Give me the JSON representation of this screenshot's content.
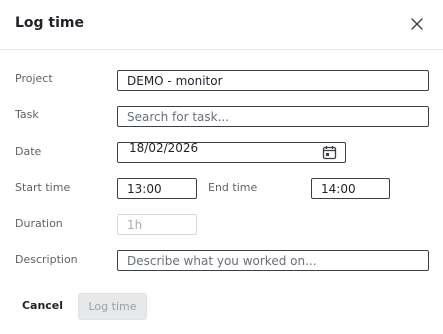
{
  "dialog": {
    "title": "Log time"
  },
  "form": {
    "project": {
      "label": "Project",
      "value": "DEMO - monitor"
    },
    "task": {
      "label": "Task",
      "placeholder": "Search for task..."
    },
    "date": {
      "label": "Date",
      "value": "18/02/2026"
    },
    "start_time": {
      "label": "Start time",
      "value": "13:00"
    },
    "end_time": {
      "label": "End time",
      "value": "14:00"
    },
    "duration": {
      "label": "Duration",
      "placeholder": "1h"
    },
    "description": {
      "label": "Description",
      "placeholder": "Describe what you worked on..."
    }
  },
  "footer": {
    "cancel_label": "Cancel",
    "submit_label": "Log time"
  },
  "icons": {
    "close": "close-icon",
    "calendar": "calendar-icon"
  }
}
